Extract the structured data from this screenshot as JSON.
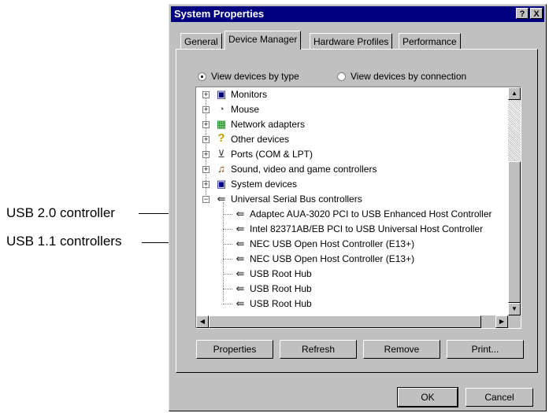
{
  "annotations": {
    "usb20": "USB 2.0 controller",
    "usb11": "USB 1.1 controllers"
  },
  "window": {
    "title": "System Properties",
    "help_button": "?",
    "close_button": "X"
  },
  "tabs": [
    {
      "label": "General",
      "active": false
    },
    {
      "label": "Device Manager",
      "active": true
    },
    {
      "label": "Hardware Profiles",
      "active": false
    },
    {
      "label": "Performance",
      "active": false
    }
  ],
  "view_options": {
    "by_type": "View devices by type",
    "by_connection": "View devices by connection",
    "selected": "by_type"
  },
  "device_tree": {
    "categories": [
      {
        "label": "Monitors",
        "icon": "monitor-icon",
        "expanded": false
      },
      {
        "label": "Mouse",
        "icon": "mouse-icon",
        "expanded": false
      },
      {
        "label": "Network adapters",
        "icon": "network-adapter-icon",
        "expanded": false
      },
      {
        "label": "Other devices",
        "icon": "question-mark-icon",
        "expanded": false
      },
      {
        "label": "Ports (COM & LPT)",
        "icon": "port-icon",
        "expanded": false
      },
      {
        "label": "Sound, video and game controllers",
        "icon": "sound-icon",
        "expanded": false
      },
      {
        "label": "System devices",
        "icon": "computer-icon",
        "expanded": false
      },
      {
        "label": "Universal Serial Bus controllers",
        "icon": "usb-icon",
        "expanded": true
      }
    ],
    "usb_children": [
      "Adaptec AUA-3020 PCI to USB Enhanced Host Controller",
      "Intel 82371AB/EB PCI to USB Universal Host Controller",
      "NEC USB Open Host Controller (E13+)",
      "NEC USB Open Host Controller (E13+)",
      "USB Root Hub",
      "USB Root Hub",
      "USB Root Hub"
    ]
  },
  "buttons": {
    "properties": "Properties",
    "refresh": "Refresh",
    "remove": "Remove",
    "print": "Print...",
    "ok": "OK",
    "cancel": "Cancel"
  },
  "colors": {
    "title_bar": "#000080",
    "face": "#c0c0c0"
  }
}
